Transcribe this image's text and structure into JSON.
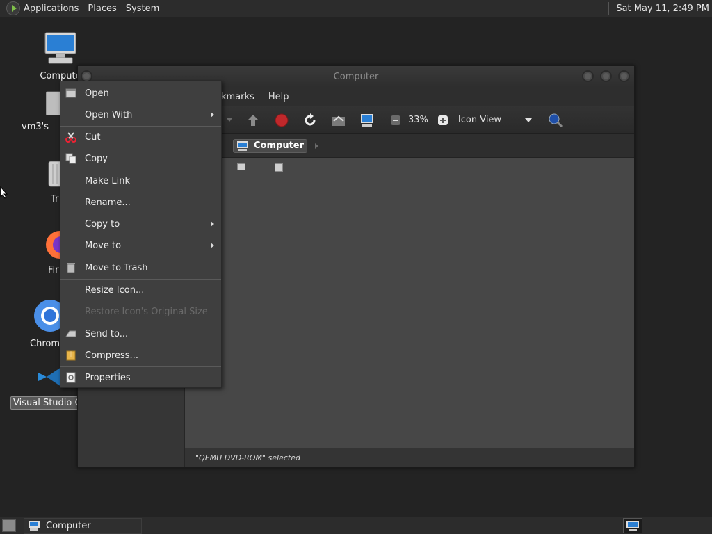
{
  "top_panel": {
    "menus": [
      "Applications",
      "Places",
      "System"
    ],
    "clock": "Sat May 11,  2:49 PM"
  },
  "desktop": {
    "icons": [
      {
        "label": "Compute",
        "icon": "computer-icon"
      },
      {
        "label": "vm3's",
        "icon": "home-folder-icon"
      },
      {
        "label": "Tr",
        "icon": "trash-icon"
      },
      {
        "label": "Fir",
        "icon": "firefox-icon"
      },
      {
        "label": "Chromi",
        "icon": "chromium-icon"
      },
      {
        "label": "Visual Studio Co",
        "icon": "vscode-icon"
      }
    ]
  },
  "window": {
    "title": "Computer",
    "menubar": [
      "kmarks",
      "Help"
    ],
    "zoom": "33%",
    "view_mode": "Icon View",
    "breadcrumb": "Computer",
    "status": "\"QEMU DVD-ROM\" selected"
  },
  "context_menu": {
    "items": [
      {
        "label": "Open",
        "icon": "open-icon"
      },
      {
        "label": "Open With",
        "submenu": true
      },
      {
        "label": "Cut",
        "icon": "scissors-icon"
      },
      {
        "label": "Copy",
        "icon": "copy-icon"
      },
      {
        "label": "Make Link"
      },
      {
        "label": "Rename..."
      },
      {
        "label": "Copy to",
        "submenu": true
      },
      {
        "label": "Move to",
        "submenu": true
      },
      {
        "label": "Move to Trash",
        "icon": "trash-icon"
      },
      {
        "label": "Resize Icon..."
      },
      {
        "label": "Restore Icon's Original Size",
        "disabled": true
      },
      {
        "label": "Send to...",
        "icon": "send-icon"
      },
      {
        "label": "Compress...",
        "icon": "compress-icon"
      },
      {
        "label": "Properties",
        "icon": "properties-icon"
      }
    ]
  },
  "taskbar": {
    "task_label": "Computer"
  },
  "colors": {
    "panel": "#2c2c2c",
    "desktop": "#232323",
    "menu": "#3f3f3f",
    "stop_red": "#c0282b",
    "refresh_white": "#f0f0f0"
  }
}
